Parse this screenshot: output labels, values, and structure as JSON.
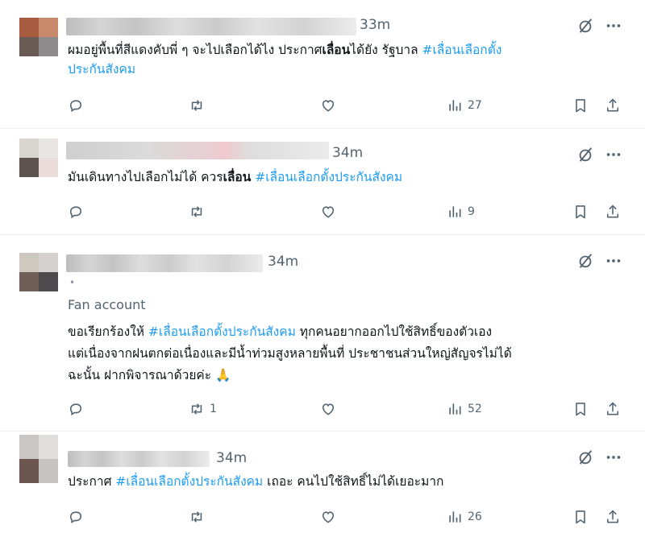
{
  "tweets": [
    {
      "time": "33m",
      "avatar_colors": [
        "#a85b3e",
        "#c98a6c",
        "#6a5a55",
        "#8f8a8c"
      ],
      "text_lines": [
        [
          {
            "t": "ผมอยู่พื้นที่สีแดงคับพี่ ๆ จะไปเลือกได้ไง ประกาศ"
          },
          {
            "t": "เลื่อน",
            "style": "bold"
          },
          {
            "t": "ได้ยัง รัฐบาล "
          },
          {
            "t": "#เลื่อนเลือกตั้ง",
            "style": "tag"
          }
        ],
        [
          {
            "t": "ประกันสังคม",
            "style": "tag"
          }
        ]
      ],
      "actions": {
        "reply": "",
        "repost": "",
        "like": "",
        "views": "27"
      }
    },
    {
      "time": "34m",
      "avatar_colors": [
        "#d9d6d0",
        "#e8e5e2",
        "#5e544f",
        "#e9dcda"
      ],
      "text_lines": [
        [
          {
            "t": "มันเดินทางไปเลือกไม่ได้ ควร"
          },
          {
            "t": "เลื่อน",
            "style": "bold"
          },
          {
            "t": " "
          },
          {
            "t": "#เลื่อนเลือกตั้งประกันสังคม",
            "style": "tag"
          }
        ]
      ],
      "actions": {
        "reply": "",
        "repost": "",
        "like": "",
        "views": "9"
      }
    },
    {
      "time": "34m",
      "badge": "Fan account",
      "avatar_colors": [
        "#cfc8c1",
        "#d6d2cf",
        "#6f5f57",
        "#4c4a4d"
      ],
      "text_lines": [
        [
          {
            "t": "ขอเรียกร้องให้ "
          },
          {
            "t": "#เลื่อนเลือกตั้งประกันสังคม",
            "style": "tag"
          },
          {
            "t": "  ทุกคนอยากออกไปใช้สิทธิ์ของตัวเอง"
          }
        ],
        [
          {
            "t": "แต่เนื่องจากฝนตกต่อเนื่องและมีน้ำท่วมสูงหลายพื้นที่ ประชาชนส่วนใหญ่สัญจรไม่ได้"
          }
        ],
        [
          {
            "t": "ฉะนั้น ฝากพิจารณาด้วยค่ะ "
          },
          {
            "t": "🙏",
            "style": "emoji"
          }
        ]
      ],
      "actions": {
        "reply": "",
        "repost": "1",
        "like": "",
        "views": "52"
      }
    },
    {
      "time": "34m",
      "avatar_colors": [
        "#c9c7c5",
        "#e0dedc",
        "#6b5750",
        "#c7c3c1"
      ],
      "text_lines": [
        [
          {
            "t": "ประกาศ "
          },
          {
            "t": "#เลื่อนเลือกตั้งประกันสังคม",
            "style": "tag"
          },
          {
            "t": " เถอะ คนไปใช้สิทธิ์ไม่ได้เยอะมาก"
          }
        ]
      ],
      "actions": {
        "reply": "",
        "repost": "",
        "like": "",
        "views": "26"
      }
    }
  ],
  "icons": {
    "grok": "grok-icon",
    "more": "more-icon",
    "reply": "reply-icon",
    "repost": "repost-icon",
    "like": "like-icon",
    "views": "views-icon",
    "bookmark": "bookmark-icon",
    "share": "share-icon"
  },
  "colors": {
    "hashtag": "#1d9bf0",
    "muted": "#536471",
    "divider": "#eff3f4"
  }
}
